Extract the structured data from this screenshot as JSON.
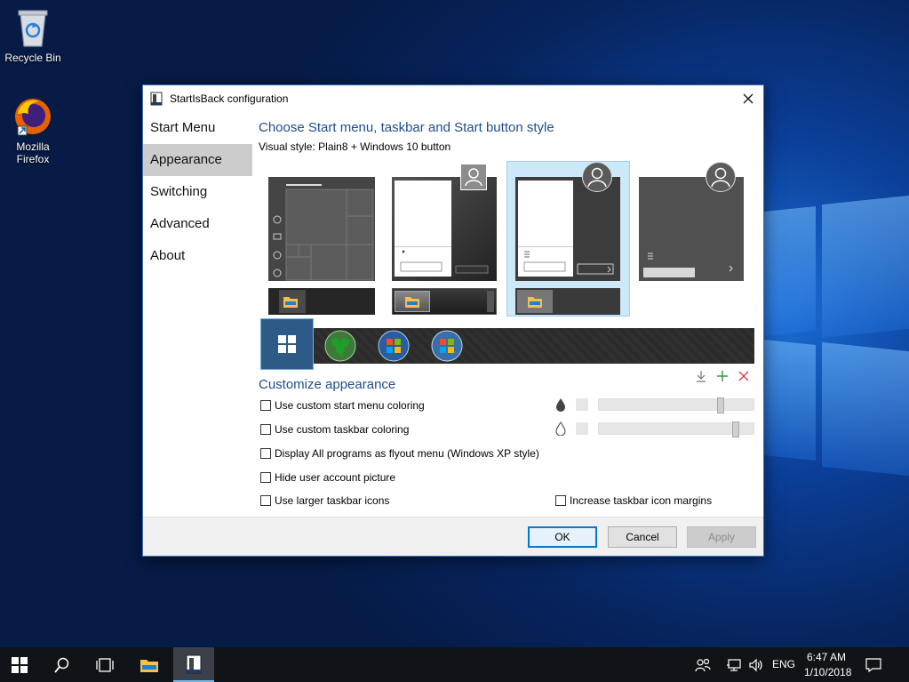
{
  "desktop": {
    "icons": [
      {
        "label": "Recycle Bin",
        "icon": "recycle-bin-icon"
      },
      {
        "label": "Mozilla Firefox",
        "icon": "firefox-icon"
      }
    ]
  },
  "dialog": {
    "title": "StartIsBack configuration",
    "nav": [
      "Start Menu",
      "Appearance",
      "Switching",
      "Advanced",
      "About"
    ],
    "active_nav": "Appearance",
    "heading": "Choose Start menu, taskbar and Start button style",
    "visual_style": "Visual style:  Plain8 + Windows 10 button",
    "customize_heading": "Customize appearance",
    "options": {
      "custom_start_coloring": "Use custom start menu coloring",
      "custom_taskbar_coloring": "Use custom taskbar coloring",
      "flyout_menu": "Display All programs as flyout menu (Windows XP style)",
      "hide_account_picture": "Hide user account picture",
      "larger_icons": "Use larger taskbar icons",
      "icon_margins": "Increase taskbar icon margins"
    },
    "buttons": {
      "ok": "OK",
      "cancel": "Cancel",
      "apply": "Apply"
    }
  },
  "taskbar": {
    "language": "ENG",
    "time": "6:47 AM",
    "date": "1/10/2018"
  },
  "colors": {
    "accent": "#0078d7",
    "heading_blue": "#1e4e8c",
    "selection": "#cde8f8"
  }
}
